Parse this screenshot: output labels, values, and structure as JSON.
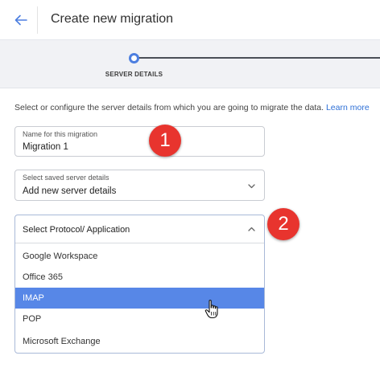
{
  "header": {
    "title": "Create new migration",
    "back_icon": "arrow-left-icon"
  },
  "stepper": {
    "steps": [
      {
        "label": "SERVER DETAILS",
        "active": true
      }
    ],
    "accent": "#4d7fe0"
  },
  "description": {
    "text": "Select or configure the server details from which you are going to migrate the data.",
    "link": "Learn more"
  },
  "form": {
    "name_field": {
      "label": "Name for this migration",
      "value": "Migration 1"
    },
    "saved_server": {
      "label": "Select saved server details",
      "value": "Add new server details"
    },
    "protocol": {
      "placeholder": "Select Protocol/ Application",
      "options": [
        "Google Workspace",
        "Office 365",
        "IMAP",
        "POP",
        "Microsoft Exchange"
      ],
      "highlighted": "IMAP"
    }
  },
  "annotations": {
    "badge_1": "1",
    "badge_2": "2",
    "color": "#e8342e"
  }
}
